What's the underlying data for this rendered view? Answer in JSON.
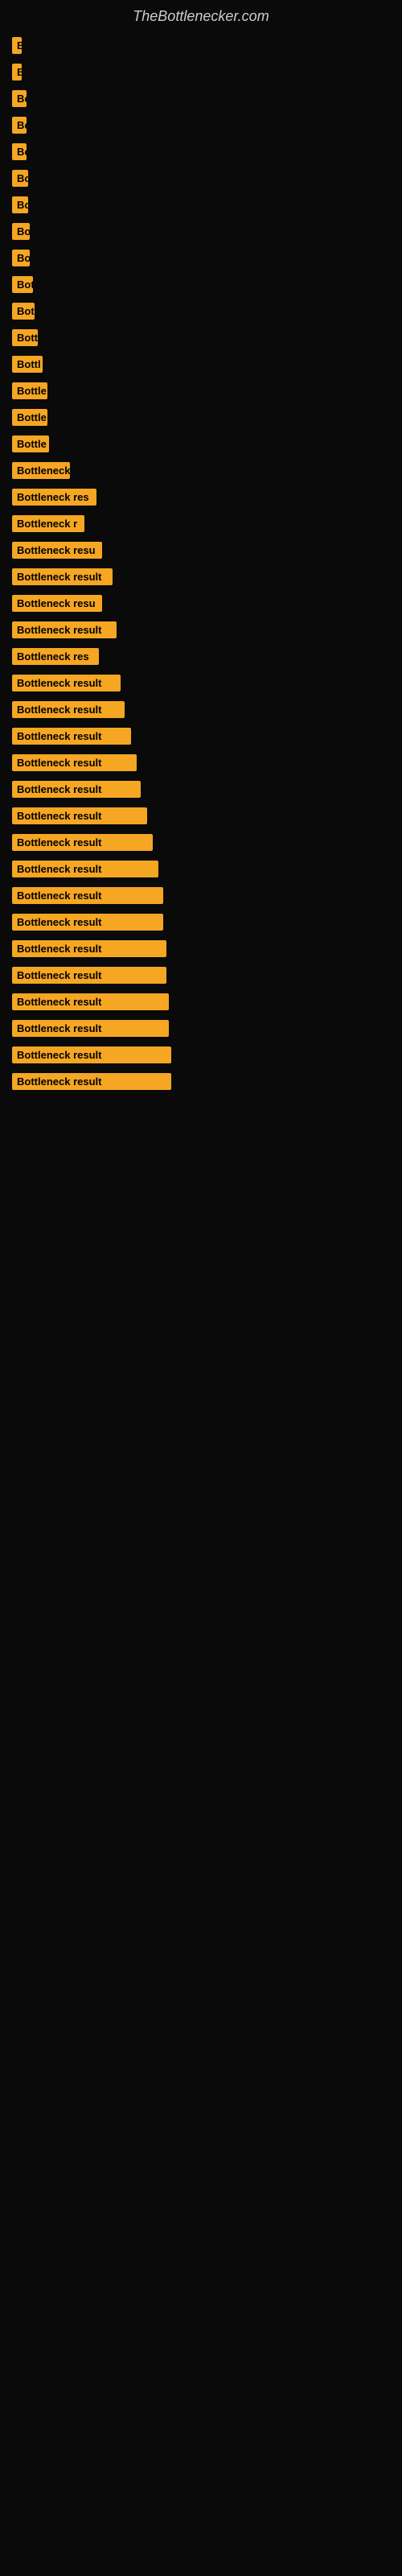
{
  "header": {
    "title": "TheBottlenecker.com"
  },
  "items": [
    {
      "label": "B",
      "width": 12
    },
    {
      "label": "B",
      "width": 12
    },
    {
      "label": "Bo",
      "width": 18
    },
    {
      "label": "Bo",
      "width": 18
    },
    {
      "label": "Bo",
      "width": 18
    },
    {
      "label": "Bo",
      "width": 20
    },
    {
      "label": "Bo",
      "width": 20
    },
    {
      "label": "Bo",
      "width": 22
    },
    {
      "label": "Bo",
      "width": 22
    },
    {
      "label": "Bot",
      "width": 26
    },
    {
      "label": "Bot",
      "width": 28
    },
    {
      "label": "Bott",
      "width": 32
    },
    {
      "label": "Bottl",
      "width": 38
    },
    {
      "label": "Bottle",
      "width": 44
    },
    {
      "label": "Bottle",
      "width": 44
    },
    {
      "label": "Bottle",
      "width": 46
    },
    {
      "label": "Bottleneck",
      "width": 72
    },
    {
      "label": "Bottleneck res",
      "width": 105
    },
    {
      "label": "Bottleneck r",
      "width": 90
    },
    {
      "label": "Bottleneck resu",
      "width": 112
    },
    {
      "label": "Bottleneck result",
      "width": 125
    },
    {
      "label": "Bottleneck resu",
      "width": 112
    },
    {
      "label": "Bottleneck result",
      "width": 130
    },
    {
      "label": "Bottleneck res",
      "width": 108
    },
    {
      "label": "Bottleneck result",
      "width": 135
    },
    {
      "label": "Bottleneck result",
      "width": 140
    },
    {
      "label": "Bottleneck result",
      "width": 148
    },
    {
      "label": "Bottleneck result",
      "width": 155
    },
    {
      "label": "Bottleneck result",
      "width": 160
    },
    {
      "label": "Bottleneck result",
      "width": 168
    },
    {
      "label": "Bottleneck result",
      "width": 175
    },
    {
      "label": "Bottleneck result",
      "width": 182
    },
    {
      "label": "Bottleneck result",
      "width": 188
    },
    {
      "label": "Bottleneck result",
      "width": 188
    },
    {
      "label": "Bottleneck result",
      "width": 192
    },
    {
      "label": "Bottleneck result",
      "width": 192
    },
    {
      "label": "Bottleneck result",
      "width": 195
    },
    {
      "label": "Bottleneck result",
      "width": 195
    },
    {
      "label": "Bottleneck result",
      "width": 198
    },
    {
      "label": "Bottleneck result",
      "width": 198
    }
  ]
}
